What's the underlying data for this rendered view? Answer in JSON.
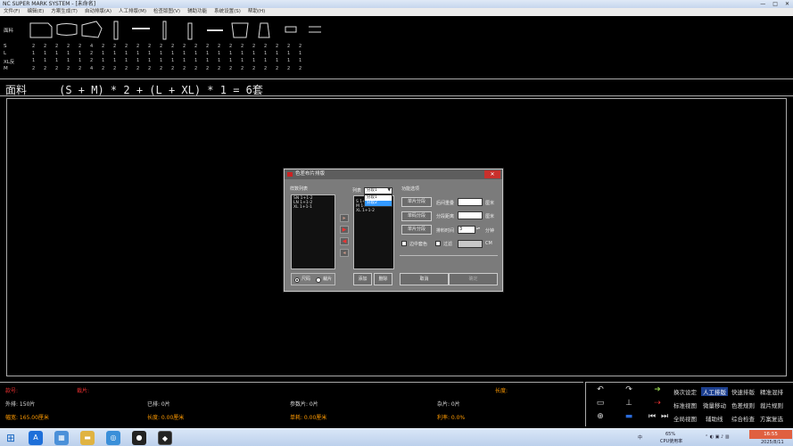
{
  "window": {
    "title": "NC SUPER MARK SYSTEM - [未命名]"
  },
  "menu": [
    "文件(F)",
    "编辑(E)",
    "方案生成(T)",
    "自动排版(A)",
    "人工排版(M)",
    "检查版图(V)",
    "辅助功能",
    "系统设置(S)",
    "帮助(H)"
  ],
  "pieces": {
    "material_label": "面料",
    "sizes": [
      "S",
      "L",
      "XL反",
      "M"
    ],
    "qty_rows": [
      [
        "2",
        "2",
        "2",
        "2",
        "2",
        "4",
        "2",
        "2",
        "2",
        "2",
        "2",
        "2",
        "2",
        "2",
        "2",
        "2",
        "2",
        "2",
        "2",
        "2",
        "2",
        "2",
        "2",
        "2"
      ],
      [
        "1",
        "1",
        "1",
        "1",
        "1",
        "2",
        "1",
        "1",
        "1",
        "1",
        "1",
        "1",
        "1",
        "1",
        "1",
        "1",
        "1",
        "1",
        "1",
        "1",
        "1",
        "1",
        "1",
        "1"
      ],
      [
        "1",
        "1",
        "1",
        "1",
        "1",
        "2",
        "1",
        "1",
        "1",
        "1",
        "1",
        "1",
        "1",
        "1",
        "1",
        "1",
        "1",
        "1",
        "1",
        "1",
        "1",
        "1",
        "1",
        "1"
      ],
      [
        "2",
        "2",
        "2",
        "2",
        "2",
        "4",
        "2",
        "2",
        "2",
        "2",
        "2",
        "2",
        "2",
        "2",
        "2",
        "2",
        "2",
        "2",
        "2",
        "2",
        "2",
        "2",
        "2",
        "2"
      ]
    ]
  },
  "formula": {
    "text": "面料     (S + M) * 2 + (L + XL) * 1 = 6套"
  },
  "dialog": {
    "title": "色差布片排版",
    "close_label": "✕",
    "left_group": "样数列表",
    "left_list": [
      "SN 1+1-2",
      "LN 1+1-2",
      "XL 1+1-1"
    ],
    "column_label": "列表",
    "select_value": "分段1",
    "dropdown_options": [
      "分段1",
      "分段2"
    ],
    "right_list": [
      "S 1+1-2",
      "M 1+1-1",
      "XL 1+1-2"
    ],
    "options_label": "功能选项",
    "btn_single_piece": "单片分段",
    "btn_single_code": "单码分段",
    "btn_single_split": "单片分段",
    "field_overlap": "后间重叠",
    "field_overlap_unit": "厘米",
    "field_gap": "分段距离",
    "field_gap_unit": "厘米",
    "field_time": "排料时间",
    "field_time_value": "3",
    "field_time_unit": "分钟",
    "chk_center": "边中套色",
    "chk_filter": "过滤",
    "filter_unit": "CM",
    "radio_sizes": "尺码",
    "radio_pieces": "裁片",
    "btn_add": "添加",
    "btn_delete": "删除",
    "btn_cancel": "取消",
    "btn_ok": "确定"
  },
  "status": {
    "kuanhao": "款号:",
    "caipian": "裁片:",
    "changdu": "长度:",
    "waipai": "外排: 150片",
    "yipai": "已排: 0片",
    "canshu": "参数片: 0片",
    "zapian": "杂片: 0片",
    "fukuan": "幅宽: 165.00厘米",
    "length": "长度: 0.00厘米",
    "danhao": "单耗: 0.00厘米",
    "liyonglv": "利率: 0.0%"
  },
  "tools": {
    "row1": [
      "换次设定",
      "人工排版",
      "快速排版",
      "精准混排"
    ],
    "row2": [
      "标准视图",
      "微量移动",
      "色差规则",
      "裁片规则"
    ],
    "row3": [
      "全局视图",
      "辅助线",
      "综合检查",
      "方案复选"
    ]
  },
  "taskbar": {
    "ime": "中",
    "cpu": "65%",
    "cpu_label": "CPU使用率",
    "time": "16:55",
    "date": "2025/8/11"
  },
  "colors": {
    "accent_red": "#f03030",
    "accent_orange": "#ff9a00",
    "active_tool": "#1c3f8f"
  }
}
